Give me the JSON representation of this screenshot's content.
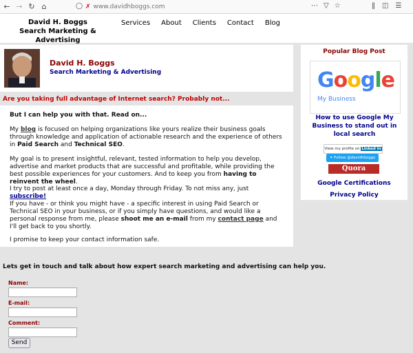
{
  "browser": {
    "url": "www.davidhboggs.com",
    "icons": [
      "back-icon",
      "forward-icon",
      "reload-icon",
      "home-icon",
      "shield-icon",
      "page-actions-icon",
      "pocket-icon",
      "bookmark-star-icon",
      "library-icon",
      "sidebar-icon",
      "menu-icon"
    ]
  },
  "header": {
    "brand_line1": "David H. Boggs",
    "brand_line2": "Search Marketing & Advertising",
    "nav": [
      "Services",
      "About",
      "Clients",
      "Contact",
      "Blog"
    ]
  },
  "profile": {
    "name": "David H. Boggs",
    "subtitle": "Search Marketing & Advertising"
  },
  "question": "Are you taking full advantage of Internet search? Probably not...",
  "content": {
    "lead": "But I can help you with that. Read on...",
    "p1_a": "My ",
    "p1_link": "blog",
    "p1_b": " is focused on helping organizations like yours realize their business goals through knowledge and application of actionable research and the experience of others in ",
    "p1_bold1": "Paid Search",
    "p1_c": " and ",
    "p1_bold2": "Technical SEO",
    "p1_d": ".",
    "p2_a": "My goal is to present insightful, relevant, tested information to help you develop, advertise and market products that are successful and profitable, while providing the best possible experiences for your customers. And to keep you from ",
    "p2_bold": "having to reinvent the wheel",
    "p2_b": ".",
    "p3_a": "I try to post at least once a day, Monday through Friday. To not miss any, just ",
    "p3_link": "subscribe!",
    "p4_a": "If you have - or think you might have - a specific interest in using Paid Search or Technical SEO in your business, or if you simply have questions, and would like a personal response from me, please ",
    "p4_bold": "shoot me an e-mail",
    "p4_b": " from my ",
    "p4_link": "contact page",
    "p4_c": " and I'll get back to you shortly.",
    "p5": "I promise to keep your contact information safe."
  },
  "sidebar": {
    "title": "Popular Blog Post",
    "google_word": [
      "G",
      "o",
      "o",
      "g",
      "l",
      "e"
    ],
    "google_sub": "My Business",
    "post_title": "How to use Google My Business to stand out in local search",
    "linkedin_badge": "View my profile on",
    "linkedin_word": "Linked in",
    "twitter_badge": "Follow @davidhboggs",
    "quora": "Quora",
    "link1": "Google Certifications",
    "link2": "Privacy Policy"
  },
  "contact": {
    "heading": "Lets get in touch and talk about how expert search marketing and advertising can help you.",
    "name_label": "Name:",
    "email_label": "E-mail:",
    "comment_label": "Comment:",
    "send": "Send"
  }
}
